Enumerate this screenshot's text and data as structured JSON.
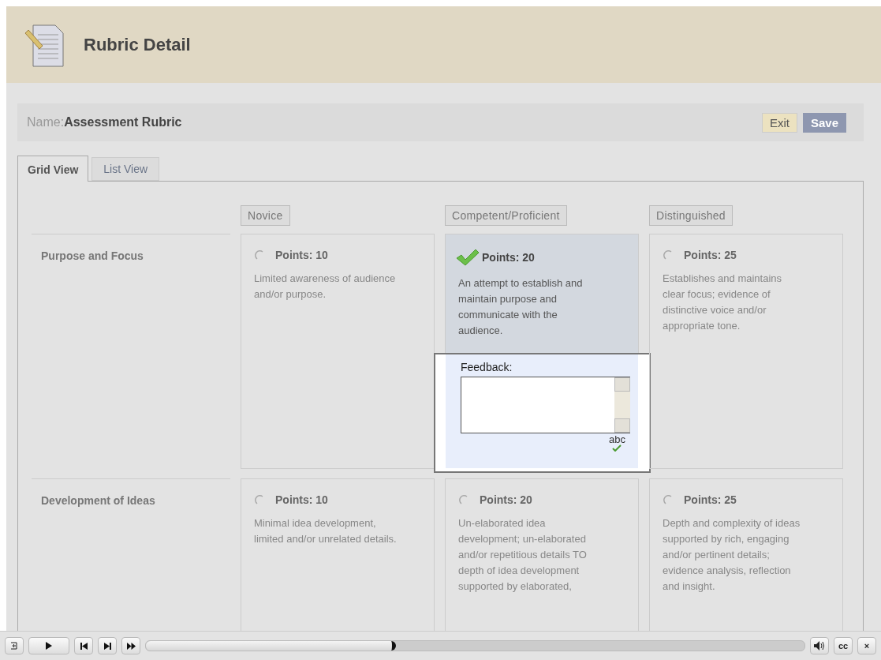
{
  "header": {
    "title": "Rubric Detail"
  },
  "name_bar": {
    "label": "Name:",
    "value": "Assessment Rubric",
    "buttons": [
      {
        "label": "Exit",
        "kind": "secondary"
      },
      {
        "label": "Save",
        "kind": "primary"
      }
    ]
  },
  "tabs": [
    {
      "label": "Grid View",
      "selected": true
    },
    {
      "label": "List View",
      "selected": false
    }
  ],
  "levels": [
    "Novice",
    "Competent/Proficient",
    "Distinguished"
  ],
  "rows": [
    {
      "criterion": "Purpose and Focus",
      "cells": [
        {
          "points": "Points: 10",
          "description": "Limited awareness of audience and/or purpose.",
          "selected": false
        },
        {
          "points": "Points: 20",
          "description": "An attempt to establish and maintain purpose and communicate with the audience.",
          "selected": true,
          "feedback": {
            "label": "Feedback:",
            "spellcheck": "abc"
          }
        },
        {
          "points": "Points: 25",
          "description": "Establishes and maintains clear focus; evidence of distinctive voice and/or appropriate tone.",
          "selected": false
        }
      ]
    },
    {
      "criterion": "Development of Ideas",
      "cells": [
        {
          "points": "Points: 10",
          "description": "Minimal idea development, limited and/or unrelated details.",
          "selected": false
        },
        {
          "points": "Points: 20",
          "description": "Un-elaborated idea development; un-elaborated and/or repetitious details TO depth of idea development supported by elaborated,",
          "selected": false
        },
        {
          "points": "Points: 25",
          "description": "Depth and complexity of ideas supported by rich, engaging and/or pertinent details; evidence analysis, reflection and insight.",
          "selected": false
        }
      ]
    }
  ],
  "player": {
    "level": 0.38,
    "captions": "cc",
    "close": "×"
  }
}
